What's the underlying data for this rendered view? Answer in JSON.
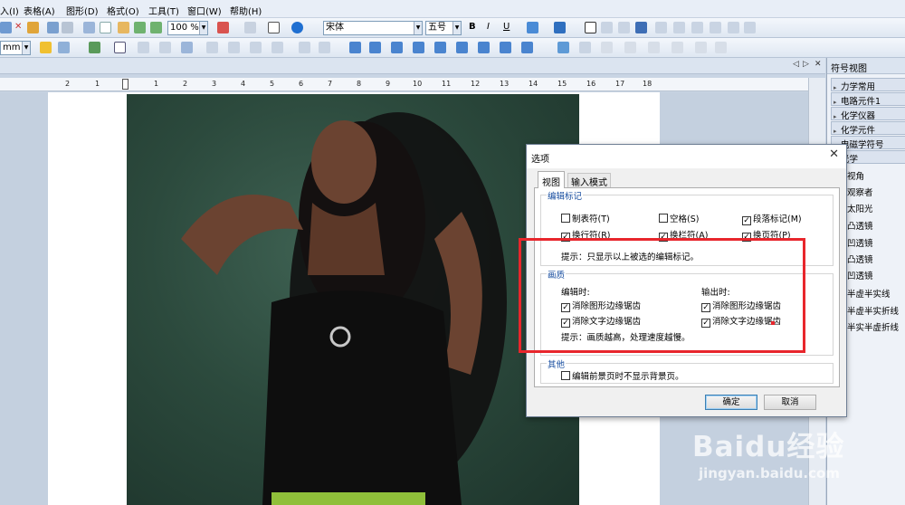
{
  "menu": [
    {
      "label": "入(I)"
    },
    {
      "label": "表格(A)"
    },
    {
      "label": "图形(D)"
    },
    {
      "label": "格式(O)"
    },
    {
      "label": "工具(T)"
    },
    {
      "label": "窗口(W)"
    },
    {
      "label": "帮助(H)"
    }
  ],
  "toolbar": {
    "zoom_value": "100 %",
    "font_name": "宋体",
    "font_size": "五号",
    "unit_value": "mm",
    "bold_label": "B",
    "italic_label": "I",
    "underline_label": "U"
  },
  "tabstrip": {
    "nav_left": "◁",
    "nav_right": "▷",
    "close": "✕"
  },
  "ruler": {
    "ticks": [
      "2",
      "1",
      "1",
      "1",
      "2",
      "3",
      "4",
      "5",
      "6",
      "7",
      "8",
      "9",
      "10",
      "11",
      "12",
      "13",
      "14",
      "15",
      "16",
      "17",
      "18"
    ]
  },
  "symbol_panel": {
    "title": "符号视图",
    "categories": [
      {
        "label": "力学常用"
      },
      {
        "label": "电路元件1"
      },
      {
        "label": "化学仪器"
      },
      {
        "label": "化学元件"
      },
      {
        "label": "电磁学符号"
      },
      {
        "label": "光学"
      }
    ],
    "optics_items": [
      {
        "label": "视角"
      },
      {
        "label": "观察者"
      },
      {
        "label": "太阳光"
      },
      {
        "label": "凸透镜"
      },
      {
        "label": "凹透镜"
      },
      {
        "label": "凸透镜"
      },
      {
        "label": "凹透镜"
      },
      {
        "label": "半虚半实线"
      },
      {
        "label": "半虚半实折线"
      },
      {
        "label": "半实半虚折线"
      }
    ]
  },
  "dialog": {
    "title": "选项",
    "close": "✕",
    "tabs": {
      "view": "视图",
      "input": "输入模式"
    },
    "edit_marks": {
      "title": "编辑标记",
      "checkboxes": [
        {
          "label": "制表符(T)",
          "checked": false
        },
        {
          "label": "空格(S)",
          "checked": false
        },
        {
          "label": "段落标记(M)",
          "checked": true
        },
        {
          "label": "换行符(R)",
          "checked": true
        },
        {
          "label": "换栏符(A)",
          "checked": true
        },
        {
          "label": "换页符(P)",
          "checked": true
        }
      ],
      "hint": "提示：只显示以上被选的编辑标记。"
    },
    "quality": {
      "title": "画质",
      "editing_label": "编辑时:",
      "output_label": "输出时:",
      "checkboxes": [
        {
          "label": "消除图形边缘锯齿",
          "checked": true
        },
        {
          "label": "消除文字边缘锯齿",
          "checked": true
        },
        {
          "label": "消除图形边缘锯齿",
          "checked": true
        },
        {
          "label": "消除文字边缘锯齿",
          "checked": true
        }
      ],
      "hint": "提示：画质越高，处理速度越慢。"
    },
    "other": {
      "title": "其他",
      "checkbox": {
        "label": "编辑前景页时不显示背景页。",
        "checked": false
      }
    },
    "ok_label": "确定",
    "cancel_label": "取消"
  },
  "watermark": {
    "logo": "Baidu经验",
    "url": "jingyan.baidu.com"
  },
  "colors": {
    "highlight": "#e8262c",
    "group_title": "#1a4fa0",
    "photo_background": "#2c4a3d"
  }
}
